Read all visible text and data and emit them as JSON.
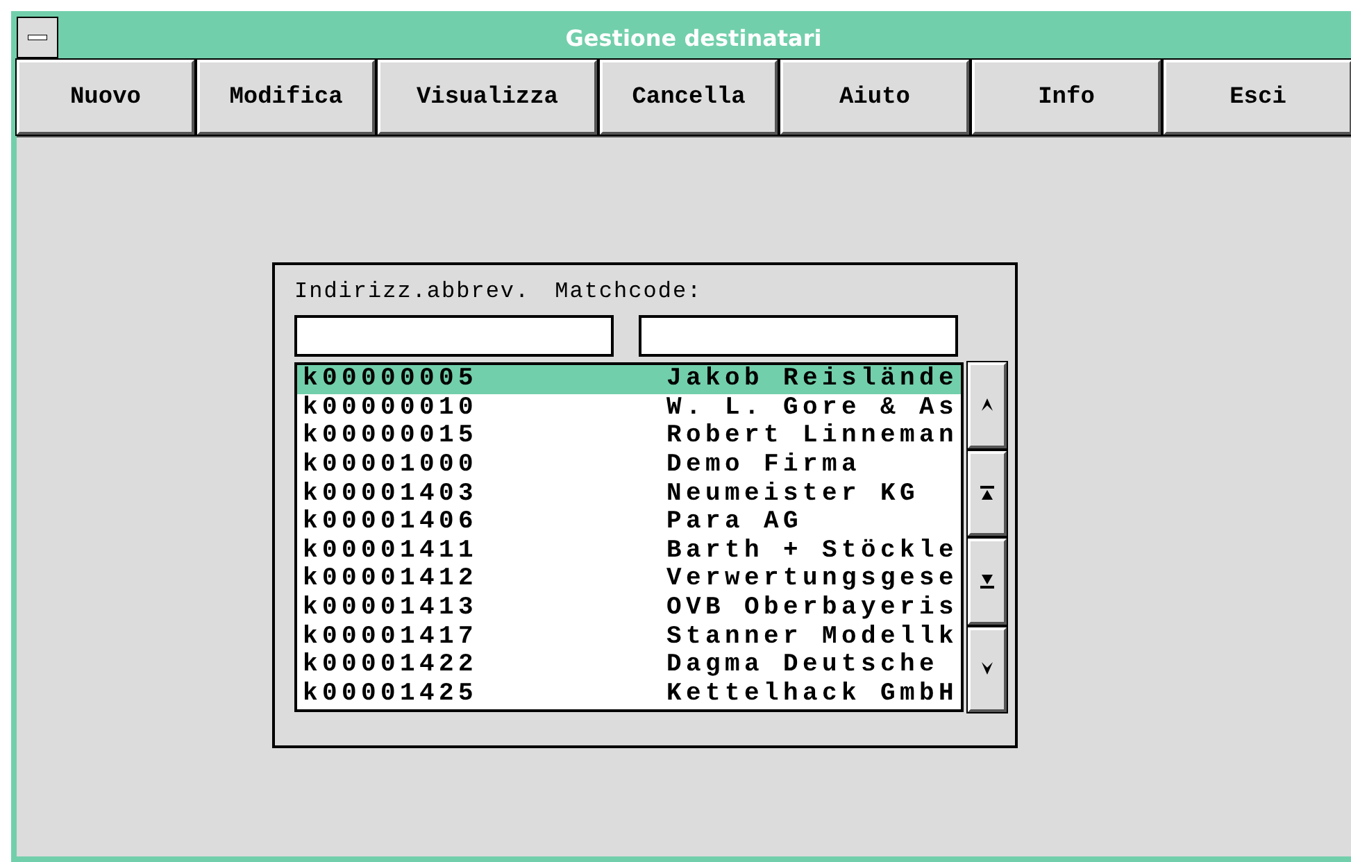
{
  "window": {
    "title": "Gestione destinatari"
  },
  "toolbar": [
    "Nuovo",
    "Modifica",
    "Visualizza",
    "Cancella",
    "Aiuto",
    "Info",
    "Esci"
  ],
  "fields": [
    {
      "label": "Indirizz.abbrev."
    },
    {
      "label": "Matchcode:"
    }
  ],
  "rows": [
    {
      "code": "k00000005",
      "name": "Jakob Reislände",
      "selected": true
    },
    {
      "code": "k00000010",
      "name": "W. L. Gore & As",
      "selected": false
    },
    {
      "code": "k00000015",
      "name": "Robert Linneman",
      "selected": false
    },
    {
      "code": "k00001000",
      "name": "Demo Firma",
      "selected": false
    },
    {
      "code": "k00001403",
      "name": "Neumeister KG",
      "selected": false
    },
    {
      "code": "k00001406",
      "name": "Para AG",
      "selected": false
    },
    {
      "code": "k00001411",
      "name": "Barth + Stöckle",
      "selected": false
    },
    {
      "code": "k00001412",
      "name": "Verwertungsgese",
      "selected": false
    },
    {
      "code": "k00001413",
      "name": "OVB Oberbayeris",
      "selected": false
    },
    {
      "code": "k00001417",
      "name": "Stanner Modellk",
      "selected": false
    },
    {
      "code": "k00001422",
      "name": "Dagma Deutsche",
      "selected": false
    },
    {
      "code": "k00001425",
      "name": "Kettelhack GmbH",
      "selected": false
    }
  ]
}
